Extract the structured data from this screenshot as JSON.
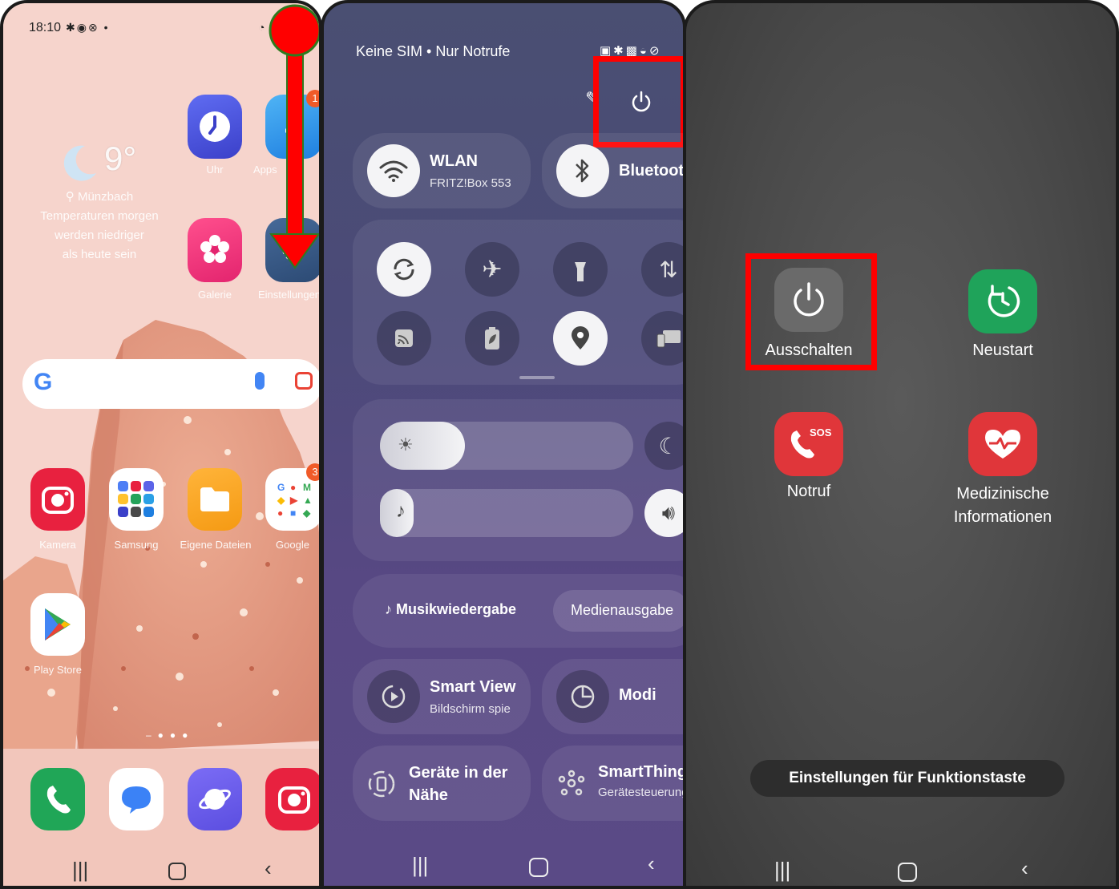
{
  "panel1": {
    "status": {
      "time": "18:10"
    },
    "weather": {
      "temp": "9°",
      "location": "Münzbach",
      "forecast_line1": "Temperaturen morgen",
      "forecast_line2": "werden niedriger",
      "forecast_line3": "als heute sein"
    },
    "apps": {
      "clock": "Uhr",
      "appstore": "Apps",
      "gallery": "Galerie",
      "settings": "Einstellungen",
      "camera": "Kamera",
      "samsung": "Samsung",
      "files": "Eigene Dateien",
      "google": "Google",
      "playstore": "Play Store"
    },
    "badges": {
      "appstore": "1",
      "google": "3"
    }
  },
  "panel2": {
    "status_text": "Keine SIM • Nur Notrufe",
    "wlan": {
      "title": "WLAN",
      "subtitle": "FRITZ!Box 553"
    },
    "bluetooth": {
      "title": "Bluetooth"
    },
    "media": {
      "left": "Musikwiedergabe",
      "right": "Medienausgabe"
    },
    "smart_view": {
      "title": "Smart View",
      "subtitle": "Bildschirm spie"
    },
    "modi": {
      "title": "Modi"
    },
    "nearby": {
      "line1": "Geräte in der",
      "line2": "Nähe"
    },
    "smartthings": {
      "title": "SmartThings",
      "subtitle": "Gerätesteuerung"
    }
  },
  "panel3": {
    "power_off": "Ausschalten",
    "restart": "Neustart",
    "emergency": "Notruf",
    "sos": "SOS",
    "medical_line1": "Medizinische",
    "medical_line2": "Informationen",
    "side_key": "Einstellungen für Funktionstaste"
  },
  "colors": {
    "highlight": "#ff0000",
    "arrow": "#ff0000",
    "restart_green": "#1fa35a",
    "sos_red": "#e0363a"
  }
}
